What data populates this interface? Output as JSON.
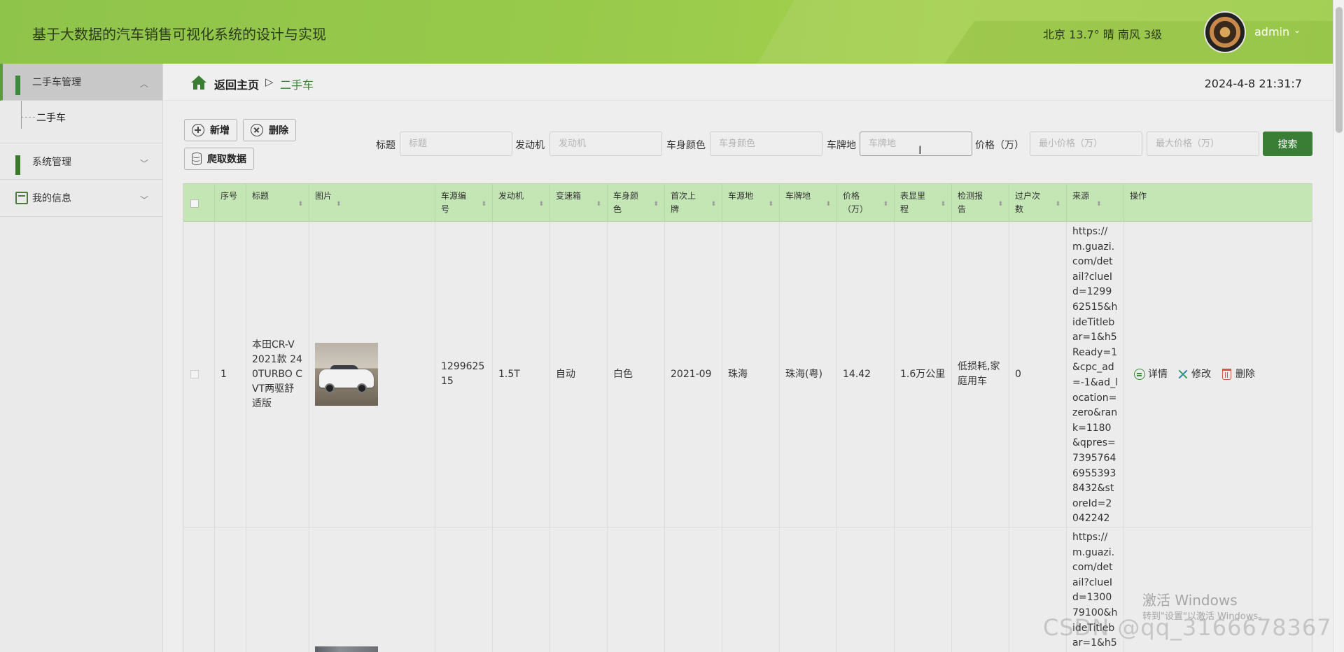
{
  "header": {
    "title": "基于大数据的汽车销售可视化系统的设计与实现",
    "weather": "北京 13.7° 晴 南风 3级",
    "user": "admin"
  },
  "sidebar": {
    "menus": [
      {
        "label": "二手车管理",
        "icon": "grid-icon",
        "expanded": true,
        "children": [
          {
            "label": "二手车"
          }
        ]
      },
      {
        "label": "系统管理",
        "icon": "grid-icon",
        "expanded": false
      },
      {
        "label": "我的信息",
        "icon": "card-icon",
        "expanded": false
      }
    ]
  },
  "breadcrumb": {
    "home": "返回主页",
    "sep": "▷",
    "current": "二手车"
  },
  "clock": "2024-4-8 21:31:7",
  "toolbar": {
    "add": "新增",
    "delete": "删除",
    "crawl": "爬取数据"
  },
  "filters": {
    "title_label": "标题",
    "title_ph": "标题",
    "engine_label": "发动机",
    "engine_ph": "发动机",
    "color_label": "车身颜色",
    "color_ph": "车身颜色",
    "plate_label": "车牌地",
    "plate_ph": "车牌地",
    "price_label": "价格（万）",
    "min_ph": "最小价格（万）",
    "max_ph": "最大价格（万）",
    "search": "搜索"
  },
  "table": {
    "headers": [
      "序号",
      "标题",
      "图片",
      "车源编号",
      "发动机",
      "变速箱",
      "车身颜色",
      "首次上牌",
      "车源地",
      "车牌地",
      "价格（万）",
      "表显里程",
      "检测报告",
      "过户次数",
      "来源",
      "操作"
    ],
    "headers_display": [
      "序号",
      "标题",
      "图片",
      "车源编\n号",
      "发动机",
      "变速箱",
      "车身颜\n色",
      "首次上\n牌",
      "车源地",
      "车牌地",
      "价格\n（万）",
      "表显里\n程",
      "检测报\n告",
      "过户次\n数",
      "来源",
      "操作"
    ],
    "rows": [
      {
        "index": "1",
        "title": "本田CR-V 2021款 240TURBO CVT两驱舒适版",
        "id": "129962515",
        "engine": "1.5T",
        "gearbox": "自动",
        "color": "白色",
        "first_reg": "2021-09",
        "origin": "珠海",
        "plate": "珠海(粤)",
        "price": "14.42",
        "mileage": "1.6万公里",
        "report": "低损耗,家庭用车",
        "transfers": "0",
        "source": "https://m.guazi.com/detail?clueId=129962515&hideTitlebar=1&h5Ready=1&cpc_ad=-1&ad_location=zero&rank=1180&qpres=739576469553938432&storeId=2042242"
      },
      {
        "source": "https://m.guazi.com/detail?clueId=130079100&hideTitlebar=1&h5"
      }
    ],
    "actions": {
      "detail": "详情",
      "edit": "修改",
      "delete": "删除"
    }
  },
  "watermarks": {
    "windows1": "激活 Windows",
    "windows2": "转到\"设置\"以激活 Windows。",
    "csdn": "CSDN @qq_3166678367"
  }
}
